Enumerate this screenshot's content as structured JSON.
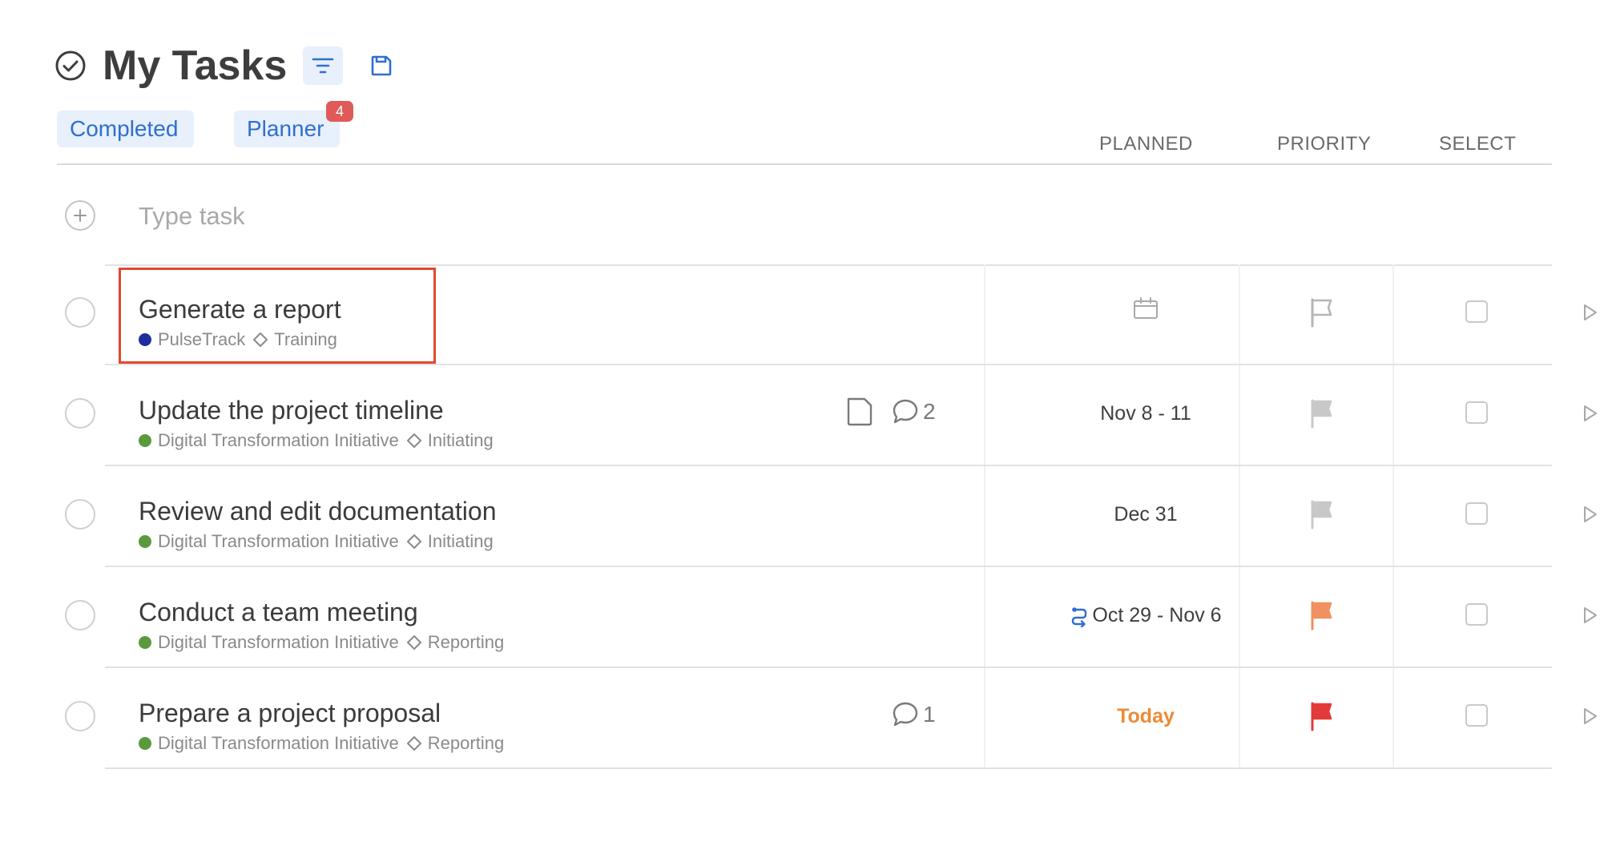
{
  "header": {
    "title": "My Tasks"
  },
  "tabs": [
    {
      "label": "Completed"
    },
    {
      "label": "Planner",
      "badge": "4"
    }
  ],
  "columns": {
    "planned": "PLANNED",
    "priority": "PRIORITY",
    "select": "SELECT"
  },
  "new_task": {
    "placeholder": "Type task"
  },
  "colors": {
    "accent": "#2f6fd0",
    "pulsetrack": "#1f2e9a",
    "digital_transformation": "#5a9a3c",
    "flag_gray": "#c8c8c8",
    "flag_orange": "#ef9160",
    "flag_red": "#e23b3b",
    "today": "#ef8a34"
  },
  "tasks": [
    {
      "title": "Generate a report",
      "project": "PulseTrack",
      "stage": "Training",
      "planned": "",
      "priority": "none"
    },
    {
      "title": "Update the project timeline",
      "project": "Digital Transformation Initiative",
      "stage": "Initiating",
      "planned": "Nov 8 - 11",
      "priority": "low",
      "has_attachment": true,
      "comments": "2"
    },
    {
      "title": "Review and edit documentation",
      "project": "Digital Transformation Initiative",
      "stage": "Initiating",
      "planned": "Dec 31",
      "priority": "low"
    },
    {
      "title": "Conduct a team meeting",
      "project": "Digital Transformation Initiative",
      "stage": "Reporting",
      "planned": "Oct 29 - Nov 6",
      "priority": "medium",
      "recurring": true
    },
    {
      "title": "Prepare a project proposal",
      "project": "Digital Transformation Initiative",
      "stage": "Reporting",
      "planned": "Today",
      "priority": "high",
      "comments": "1"
    }
  ]
}
